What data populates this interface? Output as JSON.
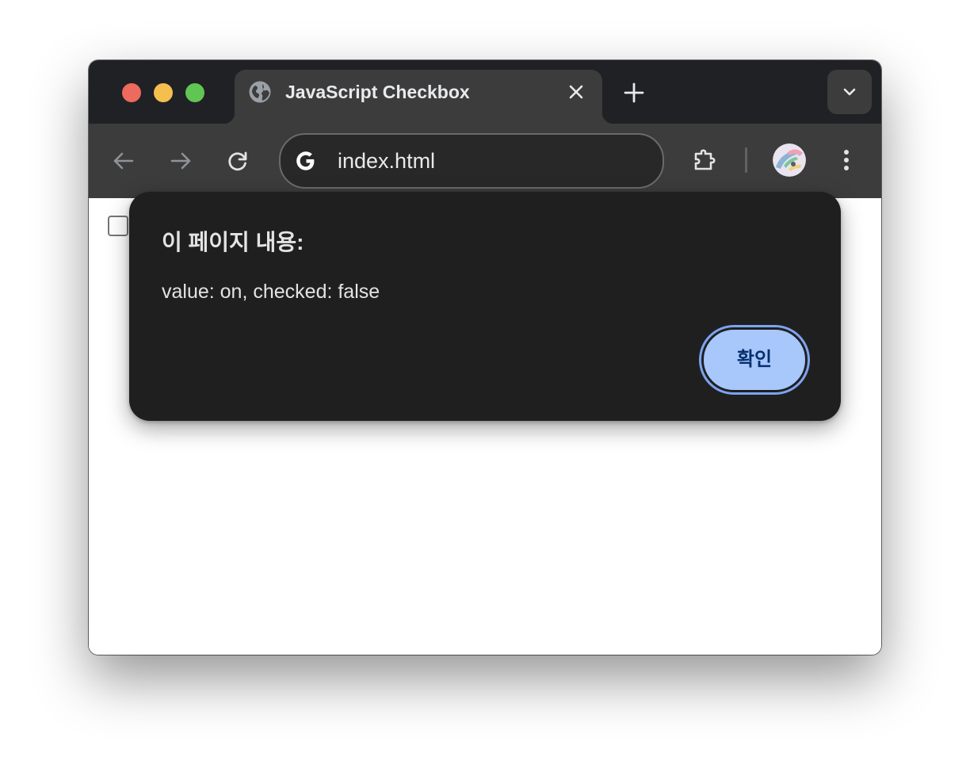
{
  "browser": {
    "tab": {
      "title": "JavaScript Checkbox",
      "favicon_icon": "globe-icon",
      "close_icon": "close-icon"
    },
    "new_tab_icon": "plus-icon",
    "tab_search_icon": "chevron-down-icon",
    "toolbar": {
      "back_icon": "arrow-left-icon",
      "forward_icon": "arrow-right-icon",
      "reload_icon": "reload-icon",
      "address_icon": "google-g-icon",
      "url": "index.html",
      "extensions_icon": "puzzle-icon",
      "menu_icon": "kebab-menu-icon"
    },
    "colors": {
      "titlebar": "#202124",
      "toolbar": "#3c3c3c",
      "traffic_red": "#ed6a5e",
      "traffic_yellow": "#f5bf4f",
      "traffic_green": "#61c554"
    }
  },
  "page": {
    "checkbox_checked": false
  },
  "dialog": {
    "title": "이 페이지 내용:",
    "message": "value: on, checked: false",
    "ok_label": "확인",
    "colors": {
      "background": "#1f1f1f",
      "button": "#a8c7fa",
      "button_text": "#062e6f",
      "focus_ring": "#7ca4f0"
    }
  }
}
